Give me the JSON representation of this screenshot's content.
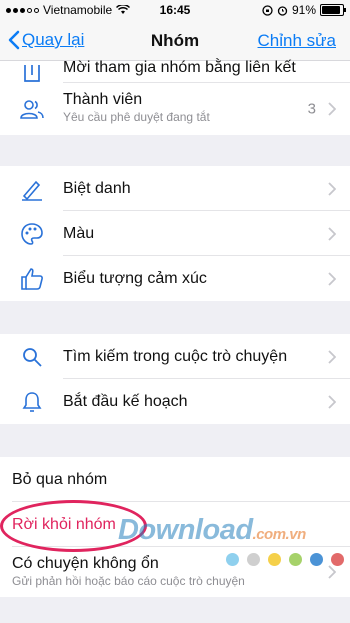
{
  "status": {
    "carrier": "Vietnamobile",
    "time": "16:45",
    "battery": "91%"
  },
  "nav": {
    "back": "Quay lại",
    "title": "Nhóm",
    "edit": "Chỉnh sửa"
  },
  "sections": {
    "top": {
      "invite": "Mời tham gia nhóm bằng liên kết",
      "members": "Thành viên",
      "members_sub": "Yêu cầu phê duyệt đang tắt",
      "members_count": "3"
    },
    "custom": {
      "nickname": "Biệt danh",
      "color": "Màu",
      "emoji": "Biểu tượng cảm xúc"
    },
    "tools": {
      "search": "Tìm kiếm trong cuộc trò chuyện",
      "plan": "Bắt đầu kế hoạch"
    },
    "actions": {
      "ignore": "Bỏ qua nhóm",
      "leave": "Rời khỏi nhóm",
      "report": "Có chuyện không ổn",
      "report_sub": "Gửi phản hồi hoặc báo cáo cuộc trò chuyện"
    }
  },
  "watermark": {
    "text": "Download",
    "suffix": ".com.vn",
    "dot_colors": [
      "#8fd0ee",
      "#cfcfcf",
      "#f5d04a",
      "#a6d26a",
      "#4b93d6",
      "#e26a6a"
    ]
  },
  "colors": {
    "accent": "#0b7cf5",
    "danger": "#e0245e",
    "icon": "#2a72d8"
  }
}
